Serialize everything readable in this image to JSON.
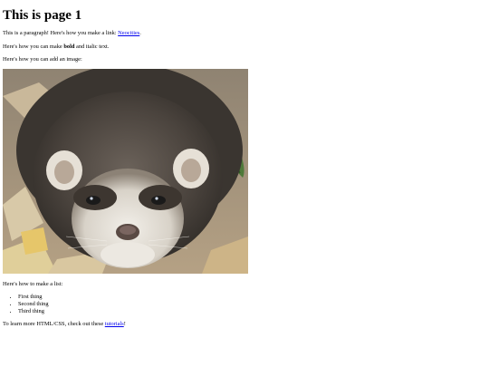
{
  "page": {
    "title": "This is page 1",
    "para1_text": "This is a paragraph! Here's how you make a link: ",
    "para1_link": "Neocities",
    "para1_end": ".",
    "para2_before": "Here's how you can make ",
    "para2_bold": "bold",
    "para2_after": " and italic text.",
    "para3": "Here's how you can add an image:",
    "image_subject": "ferret photo",
    "list_intro": "Here's how to make a list:",
    "list_items": [
      "First thing",
      "Second thing",
      "Third thing"
    ],
    "footer_before": "To learn more HTML/CSS, check out these ",
    "footer_link": "tutorials",
    "footer_end": "!"
  },
  "colors": {
    "link": "#0000ee",
    "text": "#000000",
    "background": "#ffffff"
  }
}
